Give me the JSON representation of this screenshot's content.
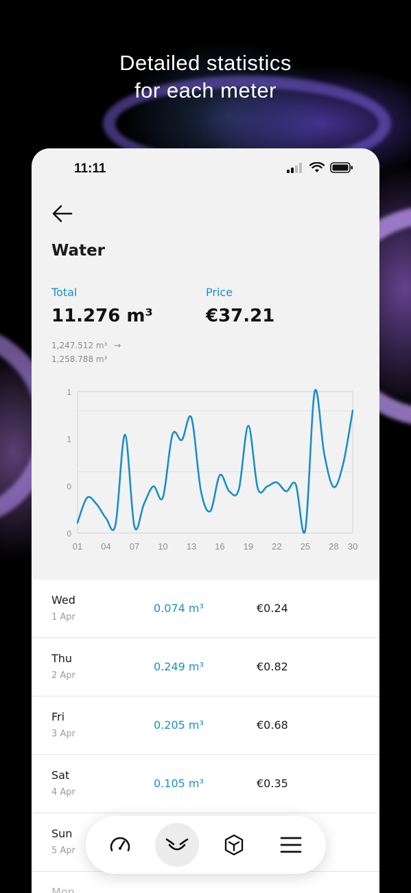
{
  "headline": {
    "line1": "Detailed statistics",
    "line2": "for each meter"
  },
  "status_bar": {
    "time": "11:11"
  },
  "page": {
    "title": "Water"
  },
  "summary": {
    "total_label": "Total",
    "total_value": "11.276 m³",
    "price_label": "Price",
    "price_value": "€37.21",
    "range_from": "1,247.512 m³",
    "range_arrow": "→",
    "range_to": "1,258.788 m³"
  },
  "chart_data": {
    "type": "line",
    "y_tick_labels": [
      "1",
      "1",
      "0",
      "0"
    ],
    "x_tick_labels": [
      "01",
      "04",
      "07",
      "10",
      "13",
      "16",
      "19",
      "22",
      "25",
      "28",
      "30"
    ],
    "x": [
      1,
      2,
      3,
      4,
      5,
      6,
      7,
      8,
      9,
      10,
      11,
      12,
      13,
      14,
      15,
      16,
      17,
      18,
      19,
      20,
      21,
      22,
      23,
      24,
      25,
      26,
      27,
      28,
      29,
      30
    ],
    "series": [
      {
        "values": [
          0.074,
          0.249,
          0.205,
          0.105,
          0.058,
          0.695,
          0.045,
          0.205,
          0.33,
          0.252,
          0.695,
          0.658,
          0.815,
          0.3,
          0.155,
          0.41,
          0.295,
          0.308,
          0.758,
          0.315,
          0.33,
          0.358,
          0.295,
          0.345,
          0.02,
          1.0,
          0.56,
          0.325,
          0.49,
          0.865
        ]
      }
    ],
    "ylim": [
      0,
      1
    ],
    "color": "#1a8fc6",
    "grid": true
  },
  "readings": [
    {
      "day": "Wed",
      "date": "1 Apr",
      "volume": "0.074 m³",
      "price": "€0.24"
    },
    {
      "day": "Thu",
      "date": "2 Apr",
      "volume": "0.249 m³",
      "price": "€0.82"
    },
    {
      "day": "Fri",
      "date": "3 Apr",
      "volume": "0.205 m³",
      "price": "€0.68"
    },
    {
      "day": "Sat",
      "date": "4 Apr",
      "volume": "0.105 m³",
      "price": "€0.35"
    },
    {
      "day": "Sun",
      "date": "5 Apr",
      "volume": "",
      "price": ""
    },
    {
      "day": "Mon",
      "date": "",
      "volume": "",
      "price": ""
    }
  ],
  "nav": {
    "items": [
      {
        "icon": "speedometer-icon",
        "active": false
      },
      {
        "icon": "meter-icon",
        "active": true
      },
      {
        "icon": "box-icon",
        "active": false
      },
      {
        "icon": "menu-icon",
        "active": false
      }
    ]
  }
}
